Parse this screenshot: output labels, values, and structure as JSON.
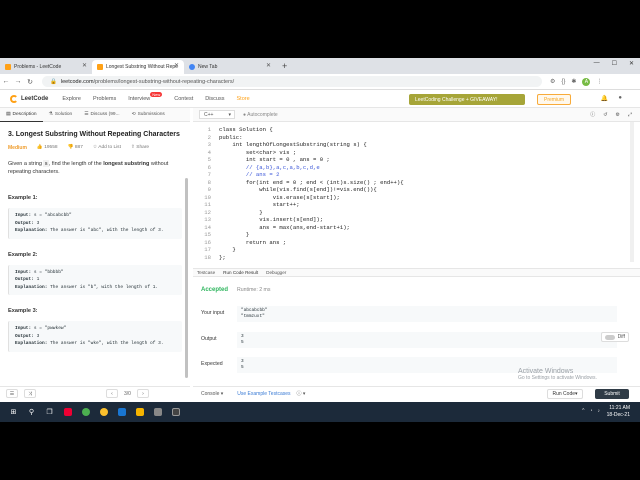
{
  "browser": {
    "tabs": [
      {
        "title": "Problems - LeetCode",
        "active": false,
        "favicon": "leetcode"
      },
      {
        "title": "Longest Substring Without Repe",
        "active": true,
        "favicon": "leetcode"
      },
      {
        "title": "New Tab",
        "active": false,
        "favicon": "chrome"
      }
    ],
    "url_host": "leetcode.com",
    "url_path": "/problems/longest-substring-without-repeating-characters/"
  },
  "header": {
    "logo": "LeetCode",
    "nav": [
      "Explore",
      "Problems",
      "Interview",
      "Contest",
      "Discuss",
      "Store"
    ],
    "new_badge": "New",
    "challenge": "LeetCoding Challenge + GIVEAWAY!",
    "premium": "Premium"
  },
  "left": {
    "tabs": [
      "Description",
      "Solution",
      "Discuss (99...",
      "Submissions"
    ],
    "title": "3. Longest Substring Without Repeating Characters",
    "difficulty": "Medium",
    "likes": "19558",
    "dislikes": "887",
    "add_to_list": "Add to List",
    "share": "Share",
    "p1": "Given a string",
    "p1_code": "s",
    "p2": ", find the length of the",
    "p3": "longest substring",
    "p4": "without repeating characters.",
    "examples": [
      {
        "heading": "Example 1:",
        "input": "s = \"abcabcbb\"",
        "output": "3",
        "explanation": "The answer is \"abc\", with the length of 3."
      },
      {
        "heading": "Example 2:",
        "input": "s = \"bbbbb\"",
        "output": "1",
        "explanation": "The answer is \"b\", with the length of 1."
      },
      {
        "heading": "Example 3:",
        "input": "s = \"pwwkew\"",
        "output": "3",
        "explanation": "The answer is \"wke\", with the length of 3."
      }
    ],
    "labels": {
      "input": "Input:",
      "output": "Output:",
      "explanation": "Explanation:"
    },
    "page_indicator": "3/0"
  },
  "editor": {
    "language": "C++",
    "autocomplete": "Autocomplete",
    "lines": [
      "class Solution {",
      "public:",
      "    int lengthOfLongestSubstring(string s) {",
      "        set<char> vis ;",
      "        int start = 0 , ans = 0 ;",
      "        // {a,b},a,c,a,b,c,d,e",
      "        // ans = 2",
      "        for(int end = 0 ; end < (int)s.size() ; end++){",
      "            while(vis.find(s[end])!=vis.end()){",
      "                vis.erase(s[start]);",
      "                start++;",
      "            }",
      "            vis.insert(s[end]);",
      "            ans = max(ans,end-start+1);",
      "        }",
      "        return ans ;",
      "    }",
      "};"
    ],
    "comment_lines": [
      6,
      7
    ]
  },
  "console": {
    "tabs": [
      "Testcase",
      "Run Code Result",
      "Debugger"
    ],
    "status": "Accepted",
    "runtime": "Runtime: 2 ms",
    "your_input_label": "Your input",
    "your_input": [
      "\"abcabcbb\"",
      "\"tmmzuxt\""
    ],
    "output_label": "Output",
    "output": [
      "3",
      "5"
    ],
    "expected_label": "Expected",
    "expected": [
      "3",
      "5"
    ],
    "diff_label": "Diff"
  },
  "bottom": {
    "console": "Console",
    "use_example": "Use Example Testcases",
    "run_code": "Run Code",
    "submit": "Submit"
  },
  "watermark": {
    "title": "Activate Windows",
    "sub": "Go to Settings to activate Windows."
  },
  "taskbar": {
    "time": "11:21 AM",
    "date": "18-Dec-21"
  },
  "colors": {
    "accent": "#ffa116",
    "accepted": "#2db55d",
    "submit": "#2f3b46"
  }
}
